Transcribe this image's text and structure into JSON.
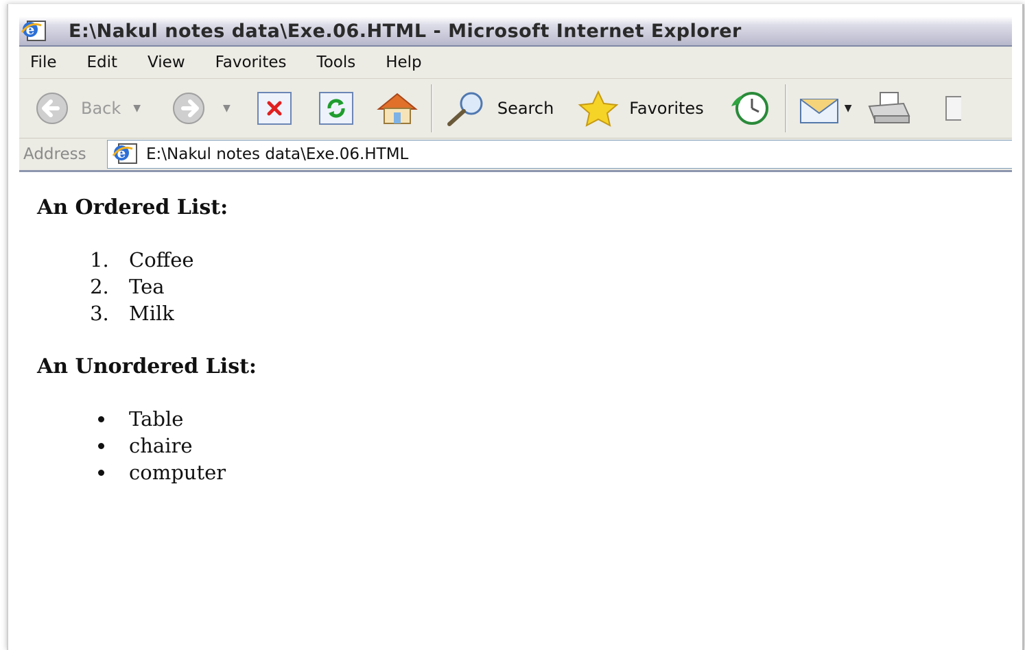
{
  "window": {
    "title": "E:\\Nakul notes data\\Exe.06.HTML - Microsoft Internet Explorer"
  },
  "menu": [
    "File",
    "Edit",
    "View",
    "Favorites",
    "Tools",
    "Help"
  ],
  "toolbar": {
    "back_label": "Back",
    "search_label": "Search",
    "favorites_label": "Favorites"
  },
  "address": {
    "label": "Address",
    "value": "E:\\Nakul notes data\\Exe.06.HTML"
  },
  "content": {
    "ordered_heading": "An Ordered List:",
    "ordered_items": [
      "Coffee",
      "Tea",
      "Milk"
    ],
    "unordered_heading": "An Unordered List:",
    "unordered_items": [
      "Table",
      "chaire",
      "computer"
    ]
  },
  "colors": {
    "menu_bg": "#ecebe4",
    "title_text": "#2a2a2a",
    "disabled_text": "#9a9a9a"
  }
}
